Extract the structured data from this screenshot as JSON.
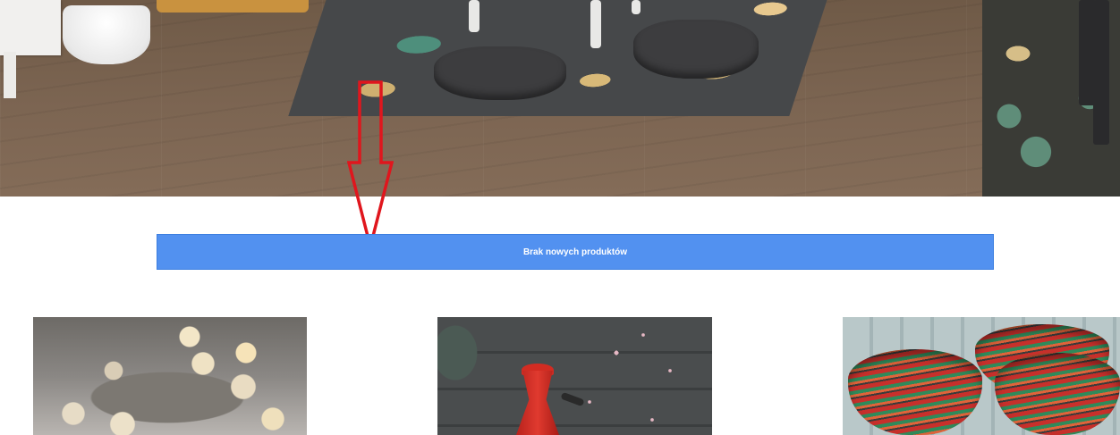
{
  "notice": {
    "label": "Brak nowych produktów"
  },
  "annotation": {
    "color": "#e0161d",
    "icon": "down-arrow-icon"
  },
  "colors": {
    "notice_bg": "#5291f0",
    "notice_text": "#ffffff"
  },
  "tiles": [
    {
      "icon": "cotton-ball-lights-photo"
    },
    {
      "icon": "red-coffee-pot-photo"
    },
    {
      "icon": "woven-baskets-photo"
    }
  ]
}
